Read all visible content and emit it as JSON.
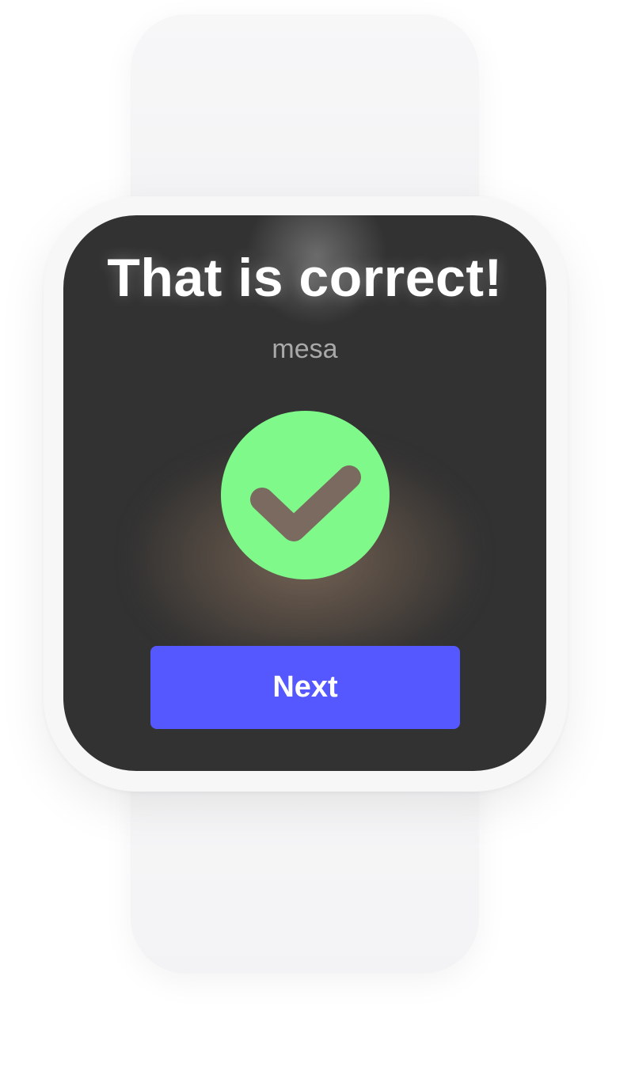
{
  "screen": {
    "title": "That is correct!",
    "word": "mesa",
    "result_icon": "check-icon",
    "next_label": "Next"
  },
  "colors": {
    "screen_background": "#323232",
    "success": "#7ef98a",
    "accent": "#5558ff",
    "watch_body": "#f7f7f8"
  }
}
